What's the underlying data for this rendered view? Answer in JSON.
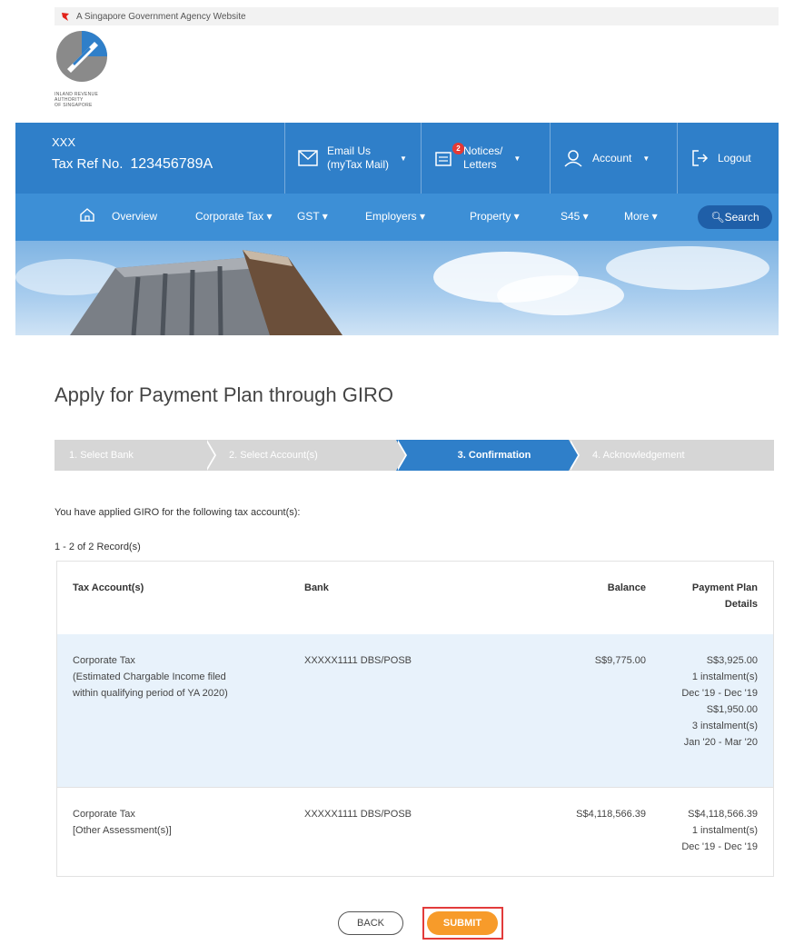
{
  "gov_bar": {
    "text": "A Singapore Government Agency Website"
  },
  "logo": {
    "lines": [
      "INLAND REVENUE",
      "AUTHORITY",
      "OF SINGAPORE"
    ]
  },
  "header": {
    "user": "XXX",
    "tax_ref_label": "Tax Ref No.",
    "tax_ref_value": "123456789A",
    "email": {
      "line1": "Email Us",
      "line2": "(myTax Mail)"
    },
    "notices": {
      "line1": "Notices/",
      "line2": "Letters",
      "badge": "2"
    },
    "account": "Account",
    "logout": "Logout"
  },
  "nav": {
    "overview": "Overview",
    "corporate_tax": "Corporate Tax ▾",
    "gst": "GST ▾",
    "employers": "Employers ▾",
    "property": "Property ▾",
    "s45": "S45 ▾",
    "more": "More ▾",
    "search": "Search"
  },
  "page": {
    "title": "Apply for Payment Plan through GIRO",
    "steps": [
      "1. Select Bank",
      "2. Select Account(s)",
      "3. Confirmation",
      "4. Acknowledgement"
    ],
    "intro": "You have applied GIRO for the following tax account(s):",
    "records": "1 - 2 of 2 Record(s)"
  },
  "table": {
    "headers": {
      "account": "Tax Account(s)",
      "bank": "Bank",
      "balance": "Balance",
      "plan_line1": "Payment Plan",
      "plan_line2": "Details"
    },
    "rows": [
      {
        "account_line1": "Corporate Tax",
        "account_line2": "(Estimated Chargable Income filed",
        "account_line3": "within qualifying period of YA 2020)",
        "bank": "XXXXX1111 DBS/POSB",
        "balance": "S$9,775.00",
        "plan": [
          "S$3,925.00",
          "1 instalment(s)",
          "Dec '19 - Dec '19",
          "S$1,950.00",
          "3 instalment(s)",
          "Jan '20 - Mar '20"
        ]
      },
      {
        "account_line1": "Corporate Tax",
        "account_line2": "[Other Assessment(s)]",
        "bank": "XXXXX1111 DBS/POSB",
        "balance": "S$4,118,566.39",
        "plan": [
          "S$4,118,566.39",
          "1 instalment(s)",
          "Dec '19 - Dec '19"
        ]
      }
    ]
  },
  "actions": {
    "back": "BACK",
    "submit": "SUBMIT"
  },
  "colors": {
    "header_blue": "#2f7fc9",
    "nav_blue": "#3d8fd6",
    "submit_orange": "#f79b2a",
    "highlight_red": "#e23b3b"
  }
}
